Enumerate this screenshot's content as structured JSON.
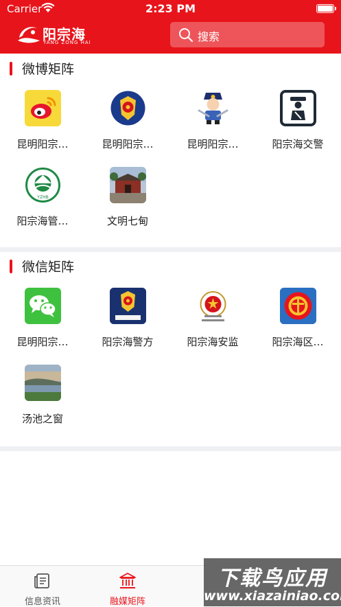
{
  "status_bar": {
    "carrier": "Carrier",
    "time": "2:23 PM"
  },
  "header": {
    "logo_text": "阳宗海",
    "logo_subtext": "YANG ZONG HAI",
    "search_placeholder": "搜索"
  },
  "sections": [
    {
      "title": "微博矩阵",
      "items": [
        {
          "label": "昆明阳宗…",
          "icon": "weibo-icon"
        },
        {
          "label": "昆明阳宗…",
          "icon": "police-badge-icon"
        },
        {
          "label": "昆明阳宗…",
          "icon": "police-mascot-icon"
        },
        {
          "label": "阳宗海交警",
          "icon": "traffic-police-icon"
        },
        {
          "label": "阳宗海管…",
          "icon": "yzhb-environment-icon"
        },
        {
          "label": "文明七甸",
          "icon": "temple-photo-icon"
        }
      ]
    },
    {
      "title": "微信矩阵",
      "items": [
        {
          "label": "昆明阳宗…",
          "icon": "wechat-icon"
        },
        {
          "label": "阳宗海警方",
          "icon": "police-badge-icon"
        },
        {
          "label": "阳宗海安监",
          "icon": "national-emblem-icon"
        },
        {
          "label": "阳宗海区…",
          "icon": "trade-union-icon"
        },
        {
          "label": "汤池之窗",
          "icon": "lake-photo-icon"
        }
      ]
    }
  ],
  "tabbar": {
    "active_color": "#e8141b",
    "inactive_color": "#555555",
    "tabs": [
      {
        "label": "信息资讯",
        "icon": "news-icon",
        "active": false
      },
      {
        "label": "融媒矩阵",
        "icon": "bank-building-icon",
        "active": true
      }
    ]
  },
  "watermark": {
    "top": "下载鸟应用",
    "bottom": "www.xiazainiao.com"
  }
}
